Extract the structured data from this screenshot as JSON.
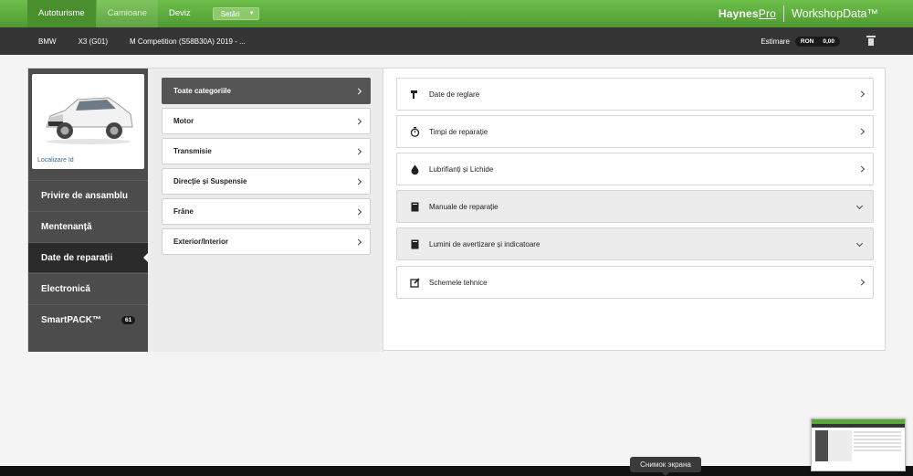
{
  "header": {
    "tabs": [
      {
        "label": "Autoturisme"
      },
      {
        "label": "Camioane"
      },
      {
        "label": "Deviz"
      }
    ],
    "settings_label": "Setări",
    "brand": "Haynes",
    "brand_suffix": "Pro",
    "product": "WorkshopData™"
  },
  "vehicle": {
    "make": "BMW",
    "model": "X3 (G01)",
    "variant": "M Competition (S58B30A) 2019 - ...",
    "estimate_label": "Estimare",
    "currency": "RON",
    "amount": "0,00"
  },
  "left_nav": {
    "locate_label": "Localizare Id",
    "items": [
      {
        "label": "Privire de ansamblu"
      },
      {
        "label": "Mentenanță"
      },
      {
        "label": "Date de reparații"
      },
      {
        "label": "Electronică"
      },
      {
        "label": "SmartPACK™",
        "badge": "61"
      }
    ]
  },
  "categories": [
    {
      "label": "Toate categoriile"
    },
    {
      "label": "Motor"
    },
    {
      "label": "Transmisie"
    },
    {
      "label": "Direcție și Suspensie"
    },
    {
      "label": "Frâne"
    },
    {
      "label": "Exterior/Interior"
    }
  ],
  "sections": [
    {
      "label": "Date de reglare",
      "icon": "wrench-icon"
    },
    {
      "label": "Timpi de reparație",
      "icon": "stopwatch-icon"
    },
    {
      "label": "Lubrifianți și Lichide",
      "icon": "drop-icon"
    },
    {
      "label": "Manuale de reparație",
      "icon": "book-icon"
    },
    {
      "label": "Lumini de avertizare și indicatoare",
      "icon": "book-icon"
    },
    {
      "label": "Schemele tehnice",
      "icon": "edit-icon"
    }
  ],
  "tooltip": "Снимок экрана",
  "colors": {
    "header_green": "#5aa83a",
    "vehicle_bar": "#353535",
    "nav_dark": "#4c4c4c",
    "link_blue": "#2d6ba3"
  }
}
